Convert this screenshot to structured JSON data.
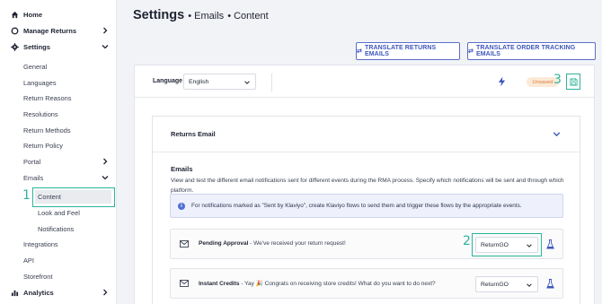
{
  "sidebar": {
    "home": "Home",
    "manage_returns": "Manage Returns",
    "settings": "Settings",
    "sub_items": [
      "General",
      "Languages",
      "Return Reasons",
      "Resolutions",
      "Return Methods",
      "Return Policy",
      "Portal",
      "Emails"
    ],
    "email_sub_items": [
      "Content",
      "Look and Feel",
      "Notifications"
    ],
    "after_items": [
      "Integrations",
      "API",
      "Storefront"
    ],
    "analytics": "Analytics"
  },
  "steps": {
    "one": "1",
    "two": "2",
    "three": "3"
  },
  "header": {
    "title": "Settings",
    "crumb1": "• Emails",
    "crumb2": "• Content",
    "translate_returns": "TRANSLATE RETURNS EMAILS",
    "translate_tracking": "TRANSLATE ORDER TRACKING EMAILS"
  },
  "language_bar": {
    "label": "Language",
    "value": "English",
    "status": "Unsaved"
  },
  "section": {
    "title": "Returns Email",
    "emails_heading": "Emails",
    "description": "View and test the different email notifications sent for different events during the RMA process. Specify which notifications will be sent and through which platform.",
    "info": "For notifications marked as \"Sent by Klaviyo\", create Klaviyo flows to send them and trigger these flows by the appropriate events."
  },
  "email_rows": [
    {
      "name": "Pending Approval",
      "text": " - We've received your return request!",
      "platform": "ReturnGO"
    },
    {
      "name": "Instant Credits",
      "text": " - Yay 🎉 Congrats on receiving store credits! What do you want to do next?",
      "platform": "ReturnGO"
    }
  ],
  "colors": {
    "accent": "#2bb39a",
    "primary": "#3d56bd",
    "unsaved_bg": "#fde9d7"
  }
}
